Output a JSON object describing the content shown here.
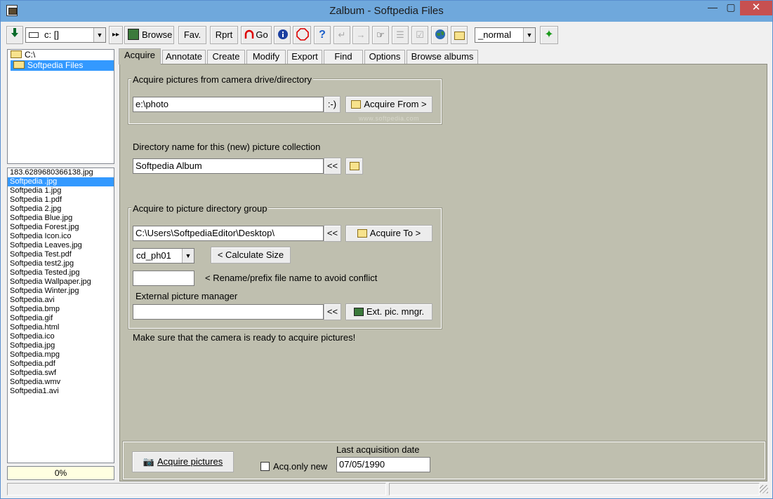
{
  "window": {
    "title": "Zalbum - Softpedia Files",
    "min": "—",
    "max": "▢",
    "close": "✕"
  },
  "toolbar": {
    "drive_value": "c: []",
    "browse": "Browse",
    "fav": "Fav.",
    "rprt": "Rprt",
    "go": "Go",
    "mode_value": "_normal"
  },
  "tree": [
    {
      "label": "C:\\"
    },
    {
      "label": "Softpedia Files"
    }
  ],
  "files": [
    "183.6289680366138.jpg",
    "Softpedia .jpg",
    "Softpedia 1.jpg",
    "Softpedia 1.pdf",
    "Softpedia 2.jpg",
    "Softpedia Blue.jpg",
    "Softpedia Forest.jpg",
    "Softpedia Icon.ico",
    "Softpedia Leaves.jpg",
    "Softpedia Test.pdf",
    "Softpedia test2.jpg",
    "Softpedia Tested.jpg",
    "Softpedia Wallpaper.jpg",
    "Softpedia Winter.jpg",
    "Softpedia.avi",
    "Softpedia.bmp",
    "Softpedia.gif",
    "Softpedia.html",
    "Softpedia.ico",
    "Softpedia.jpg",
    "Softpedia.mpg",
    "Softpedia.pdf",
    "Softpedia.swf",
    "Softpedia.wmv",
    "Softpedia1.avi"
  ],
  "progress": "0%",
  "tabs": [
    "Acquire",
    "Annotate",
    "Create",
    "Modify",
    "Export",
    "Find",
    "Options",
    "Browse albums"
  ],
  "acquire": {
    "source_group_label": "Acquire pictures from camera drive/directory",
    "source_path": "e:\\photo",
    "smiley_btn": ":-)",
    "acquire_from_btn": "Acquire From >",
    "watermark": "www.softpedia.com",
    "dir_name_label": "Directory name for this (new) picture collection",
    "dir_name_value": "Softpedia Album",
    "back_btn": "<<",
    "target_group_label": "Acquire to picture directory group",
    "target_path": "C:\\Users\\SoftpediaEditor\\Desktop\\",
    "acquire_to_btn": "Acquire To >",
    "group_select": "cd_ph01",
    "calc_size_btn": "< Calculate Size",
    "rename_value": "",
    "rename_label": "< Rename/prefix file name to avoid conflict",
    "ext_label": "External picture manager",
    "ext_value": "",
    "ext_btn": "Ext. pic. mngr.",
    "notice": "Make sure that the camera is ready to acquire pictures!",
    "acquire_btn": "Acquire pictures",
    "acq_only_new": "Acq.only new",
    "last_date_label": "Last acquisition date",
    "last_date_value": "07/05/1990"
  }
}
